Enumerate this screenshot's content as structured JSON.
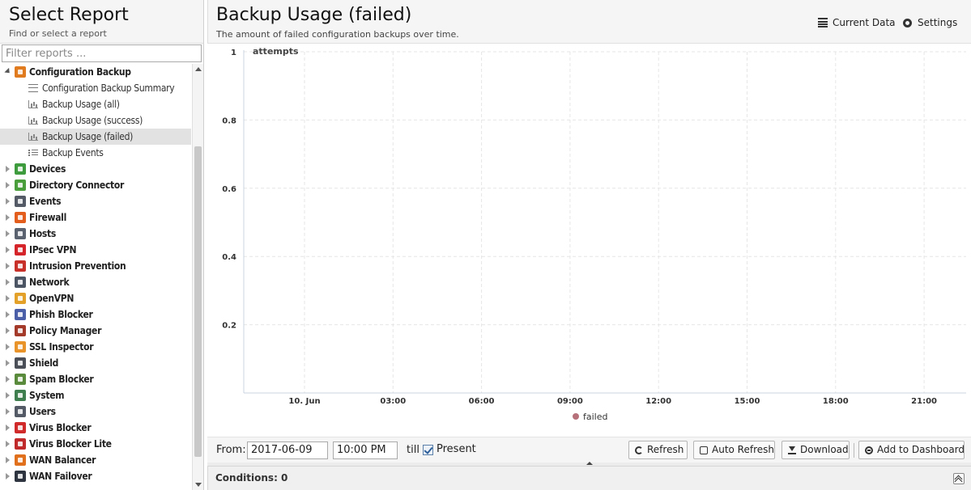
{
  "sidebar": {
    "title": "Select Report",
    "subtitle": "Find or select a report",
    "filter_placeholder": "Filter reports ...",
    "tree": [
      {
        "label": "Configuration Backup",
        "type": "category",
        "expanded": true,
        "color": "#e07b20"
      },
      {
        "label": "Configuration Backup Summary",
        "type": "child",
        "icon": "text-report-icon"
      },
      {
        "label": "Backup Usage (all)",
        "type": "child",
        "icon": "bar-chart-icon"
      },
      {
        "label": "Backup Usage (success)",
        "type": "child",
        "icon": "bar-chart-icon"
      },
      {
        "label": "Backup Usage (failed)",
        "type": "child",
        "icon": "bar-chart-icon",
        "selected": true
      },
      {
        "label": "Backup Events",
        "type": "child",
        "icon": "list-icon"
      },
      {
        "label": "Devices",
        "type": "category",
        "color": "#3e9b3e"
      },
      {
        "label": "Directory Connector",
        "type": "category",
        "color": "#4a9e3c"
      },
      {
        "label": "Events",
        "type": "category",
        "color": "#555b66"
      },
      {
        "label": "Firewall",
        "type": "category",
        "color": "#e35e1c"
      },
      {
        "label": "Hosts",
        "type": "category",
        "color": "#5b6270"
      },
      {
        "label": "IPsec VPN",
        "type": "category",
        "color": "#d6252a"
      },
      {
        "label": "Intrusion Prevention",
        "type": "category",
        "color": "#c8302a"
      },
      {
        "label": "Network",
        "type": "category",
        "color": "#4b5563"
      },
      {
        "label": "OpenVPN",
        "type": "category",
        "color": "#e3a12a"
      },
      {
        "label": "Phish Blocker",
        "type": "category",
        "color": "#4a5fa8"
      },
      {
        "label": "Policy Manager",
        "type": "category",
        "color": "#a33a2a"
      },
      {
        "label": "SSL Inspector",
        "type": "category",
        "color": "#e8942a"
      },
      {
        "label": "Shield",
        "type": "category",
        "color": "#4a4f58"
      },
      {
        "label": "Spam Blocker",
        "type": "category",
        "color": "#5a8a3c"
      },
      {
        "label": "System",
        "type": "category",
        "color": "#3f7f4f"
      },
      {
        "label": "Users",
        "type": "category",
        "color": "#555b66"
      },
      {
        "label": "Virus Blocker",
        "type": "category",
        "color": "#d02a2a"
      },
      {
        "label": "Virus Blocker Lite",
        "type": "category",
        "color": "#c02a2a"
      },
      {
        "label": "WAN Balancer",
        "type": "category",
        "color": "#e0701c"
      },
      {
        "label": "WAN Failover",
        "type": "category",
        "color": "#2f3540"
      }
    ]
  },
  "report": {
    "title": "Backup Usage (failed)",
    "description": "The amount of failed configuration backups over time.",
    "current_data_label": "Current Data",
    "settings_label": "Settings"
  },
  "chart_data": {
    "type": "line",
    "ylabel": "attempts",
    "yticks": [
      "1",
      "0.8",
      "0.6",
      "0.4",
      "0.2"
    ],
    "ylim": [
      0,
      1
    ],
    "xticks": [
      "10. Jun",
      "03:00",
      "06:00",
      "09:00",
      "12:00",
      "15:00",
      "18:00",
      "21:00"
    ],
    "grid": true,
    "legend_position": "bottom",
    "series": [
      {
        "name": "failed",
        "values": [],
        "color": "#b5707a"
      }
    ]
  },
  "toolbar": {
    "from_label": "From:",
    "date_value": "2017-06-09",
    "time_value": "10:00 PM",
    "till_label": "till",
    "present_checked": true,
    "present_label": "Present",
    "refresh_label": "Refresh",
    "auto_refresh_label": "Auto Refresh",
    "download_label": "Download",
    "add_dashboard_label": "Add to Dashboard"
  },
  "conditions": {
    "label": "Conditions: 0"
  }
}
